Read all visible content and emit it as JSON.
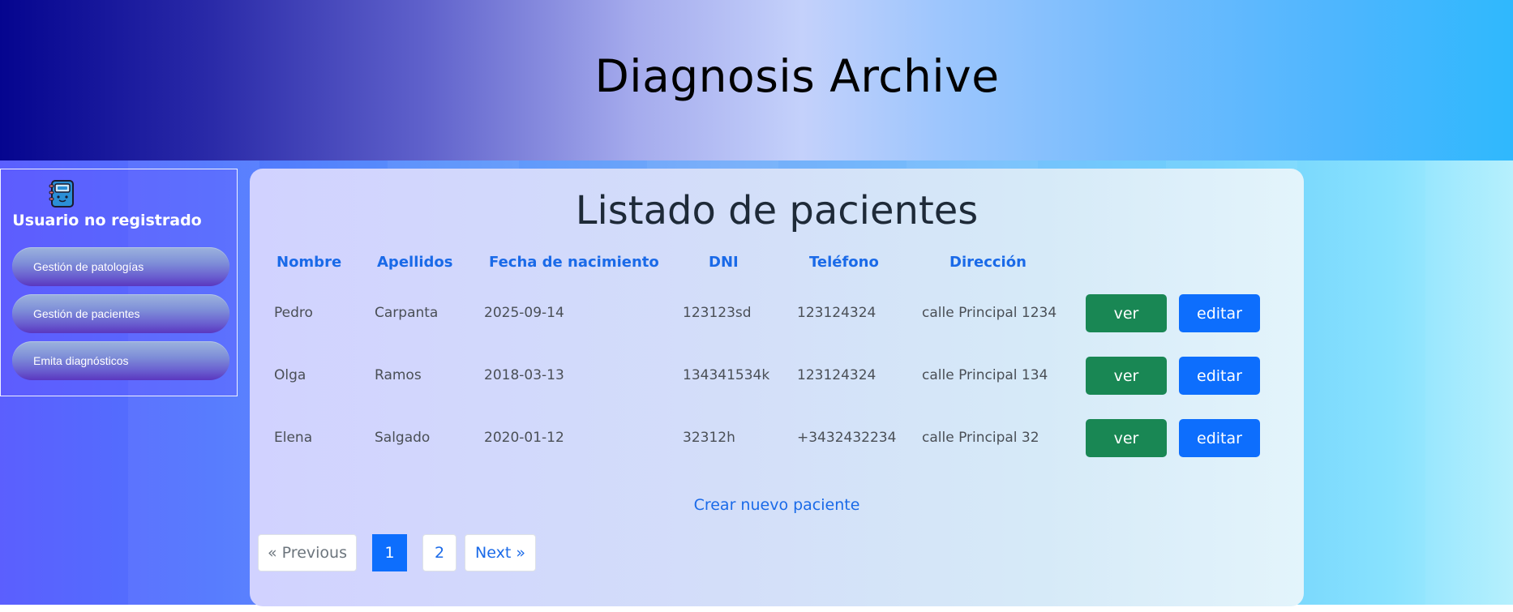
{
  "header": {
    "title": "Diagnosis Archive"
  },
  "sidebar": {
    "user_label": "Usuario no registrado",
    "items": [
      {
        "label": "Gestión de patologías"
      },
      {
        "label": "Gestión de pacientes"
      },
      {
        "label": "Emita diagnósticos"
      }
    ]
  },
  "main": {
    "title": "Listado de pacientes",
    "columns": [
      "Nombre",
      "Apellidos",
      "Fecha de nacimiento",
      "DNI",
      "Teléfono",
      "Dirección"
    ],
    "rows": [
      {
        "nombre": "Pedro",
        "apellidos": "Carpanta",
        "fecha": "2025-09-14",
        "dni": "123123sd",
        "telefono": "123124324",
        "direccion": "calle Principal 1234"
      },
      {
        "nombre": "Olga",
        "apellidos": "Ramos",
        "fecha": "2018-03-13",
        "dni": "134341534k",
        "telefono": "123124324",
        "direccion": "calle Principal 134"
      },
      {
        "nombre": "Elena",
        "apellidos": "Salgado",
        "fecha": "2020-01-12",
        "dni": "32312h",
        "telefono": "+3432432234",
        "direccion": "calle Principal 32"
      }
    ],
    "row_actions": {
      "view_label": "ver",
      "edit_label": "editar"
    },
    "create_link": "Crear nuevo paciente",
    "pagination": {
      "previous": "« Previous",
      "pages": [
        "1",
        "2"
      ],
      "current": "1",
      "next": "Next »"
    }
  },
  "colors": {
    "link": "#1a6ae8",
    "view_button": "#198754",
    "edit_button": "#0d6efd"
  },
  "icons": {
    "sidebar_logo": "notebook-icon"
  }
}
